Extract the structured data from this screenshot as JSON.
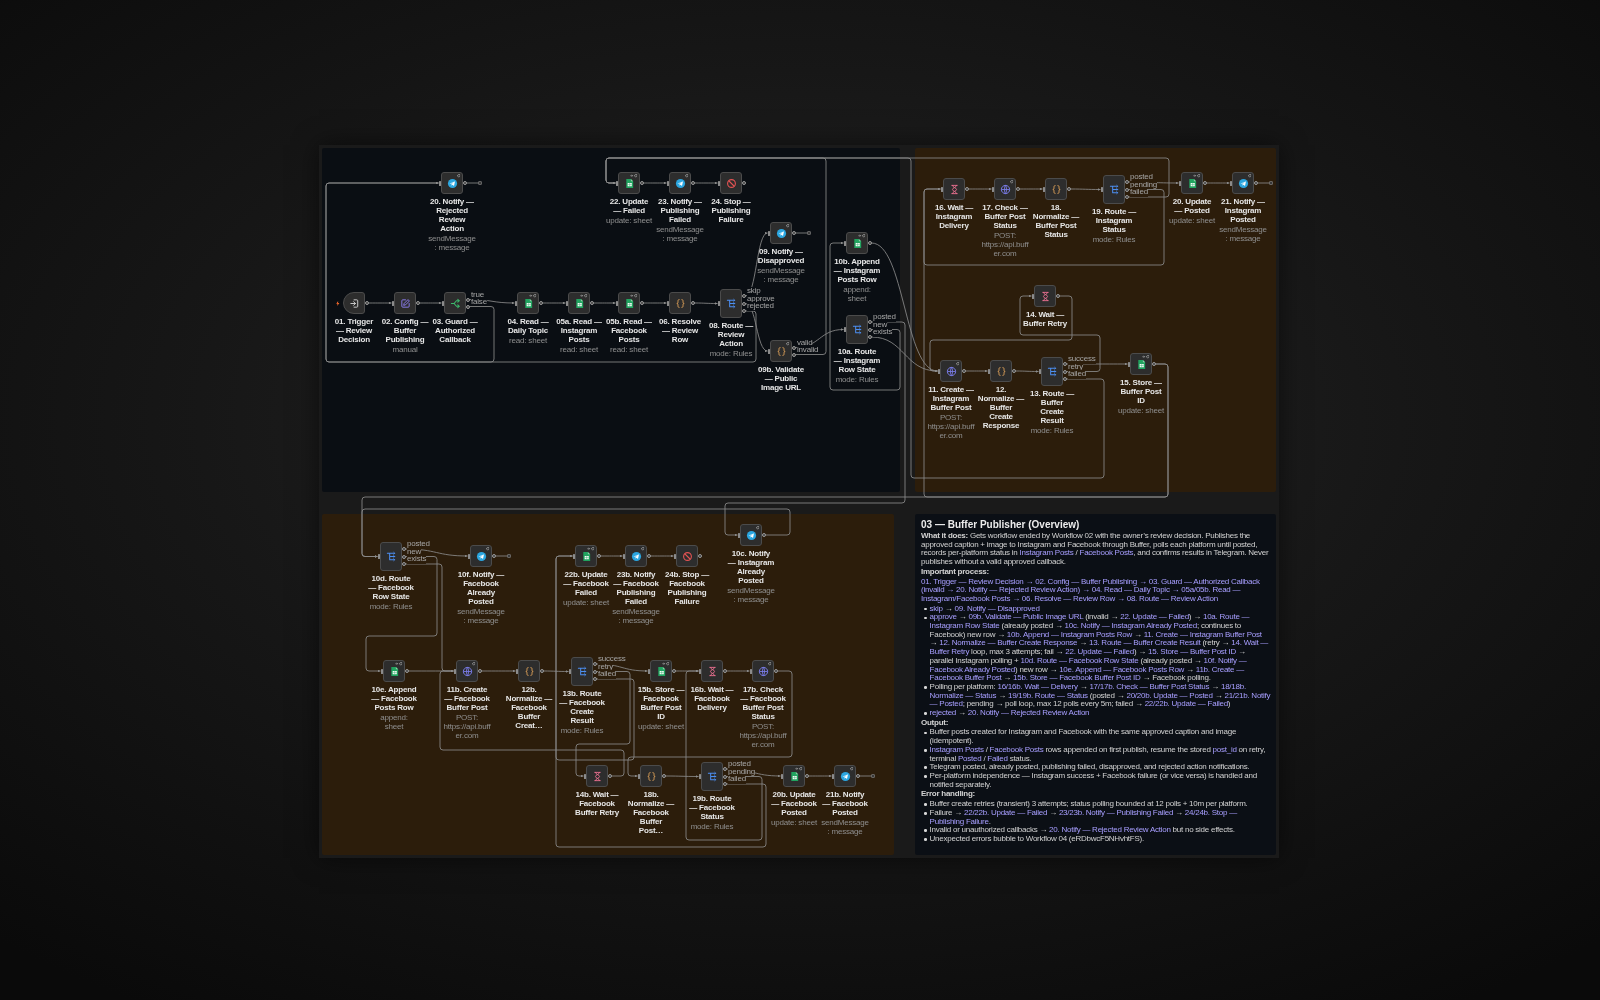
{
  "canvas": {
    "nodes": [
      {
        "label": "20. Notify — Rejected Review Action",
        "subtitle": "sendMessage: message",
        "kind": "telegram",
        "retries": true,
        "always_outputs": false
      },
      {
        "label": "22. Update — Failed",
        "subtitle": "update: sheet",
        "kind": "sheets",
        "retries": true,
        "always_outputs": true
      },
      {
        "label": "23. Notify — Publishing Failed",
        "subtitle": "sendMessage: message",
        "kind": "telegram",
        "retries": true,
        "always_outputs": false
      },
      {
        "label": "24. Stop — Publishing Failure",
        "kind": "stop",
        "retries": false,
        "always_outputs": false
      },
      {
        "label": "16. Wait — Instagram Delivery",
        "kind": "wait",
        "retries": false,
        "always_outputs": false
      },
      {
        "label": "17. Check — Buffer Post Status",
        "subtitle": "POST: https://api.buffer.com",
        "kind": "http",
        "retries": true,
        "always_outputs": false
      },
      {
        "label": "18. Normalize — Buffer Post Status",
        "kind": "code",
        "retries": false,
        "always_outputs": false
      },
      {
        "label": "19. Route — Instagram Status",
        "subtitle": "mode: Rules",
        "kind": "switch",
        "outputs": [
          "posted",
          "pending",
          "failed"
        ],
        "retries": false,
        "always_outputs": false
      },
      {
        "label": "20. Update — Posted",
        "subtitle": "update: sheet",
        "kind": "sheets",
        "retries": true,
        "always_outputs": true
      },
      {
        "label": "21. Notify — Instagram Posted",
        "subtitle": "sendMessage: message",
        "kind": "telegram",
        "retries": true,
        "always_outputs": false
      },
      {
        "label": "09. Notify — Disapproved",
        "subtitle": "sendMessage: message",
        "kind": "telegram",
        "retries": true,
        "always_outputs": false
      },
      {
        "label": "10b. Append — Instagram Posts Row",
        "subtitle": "append: sheet",
        "kind": "sheets",
        "retries": true,
        "always_outputs": true
      },
      {
        "label": "01. Trigger — Review Decision",
        "kind": "trigger",
        "retries": false,
        "always_outputs": false
      },
      {
        "label": "02. Config — Buffer Publishing",
        "subtitle": "manual",
        "kind": "set",
        "retries": false,
        "always_outputs": false
      },
      {
        "label": "03. Guard — Authorized Callback",
        "kind": "if",
        "outputs": [
          "true",
          "false"
        ],
        "retries": false,
        "always_outputs": false
      },
      {
        "label": "04. Read — Daily Topic",
        "subtitle": "read: sheet",
        "kind": "sheets",
        "retries": true,
        "always_outputs": true
      },
      {
        "label": "05a. Read — Instagram Posts",
        "subtitle": "read: sheet",
        "kind": "sheets",
        "retries": true,
        "always_outputs": true
      },
      {
        "label": "05b. Read — Facebook Posts",
        "subtitle": "read: sheet",
        "kind": "sheets",
        "retries": true,
        "always_outputs": true
      },
      {
        "label": "06. Resolve — Review Row",
        "kind": "code",
        "retries": false,
        "always_outputs": false
      },
      {
        "label": "08. Route — Review Action",
        "subtitle": "mode: Rules",
        "kind": "switch",
        "outputs": [
          "skip",
          "approve",
          "rejected"
        ],
        "retries": false,
        "always_outputs": false
      },
      {
        "label": "14. Wait — Buffer Retry",
        "kind": "wait",
        "retries": false,
        "always_outputs": false
      },
      {
        "label": "09b. Validate — Public Image URL",
        "kind": "code",
        "outputs": [
          "valid",
          "invalid"
        ],
        "retries": true,
        "always_outputs": false
      },
      {
        "label": "10a. Route — Instagram Row State",
        "subtitle": "mode: Rules",
        "kind": "switch",
        "outputs": [
          "posted",
          "new",
          "exists"
        ],
        "retries": false,
        "always_outputs": false
      },
      {
        "label": "11. Create — Instagram Buffer Post",
        "subtitle": "POST: https://api.buffer.com",
        "kind": "http",
        "retries": true,
        "always_outputs": false
      },
      {
        "label": "12. Normalize — Buffer Create Response",
        "kind": "code",
        "retries": false,
        "always_outputs": false
      },
      {
        "label": "13. Route — Buffer Create Result",
        "subtitle": "mode: Rules",
        "kind": "switch",
        "outputs": [
          "success",
          "retry",
          "failed"
        ],
        "retries": false,
        "always_outputs": false
      },
      {
        "label": "15. Store — Buffer Post ID",
        "subtitle": "update: sheet",
        "kind": "sheets",
        "retries": true,
        "always_outputs": true
      },
      {
        "label": "10d. Route — Facebook Row State",
        "subtitle": "mode: Rules",
        "kind": "switch",
        "outputs": [
          "posted",
          "new",
          "exists"
        ],
        "retries": false,
        "always_outputs": false
      },
      {
        "label": "10f. Notify — Facebook Already Posted",
        "subtitle": "sendMessage: message",
        "kind": "telegram",
        "retries": true,
        "always_outputs": false
      },
      {
        "label": "22b. Update — Facebook Failed",
        "subtitle": "update: sheet",
        "kind": "sheets",
        "retries": true,
        "always_outputs": true
      },
      {
        "label": "23b. Notify — Facebook Publishing Failed",
        "subtitle": "sendMessage: message",
        "kind": "telegram",
        "retries": true,
        "always_outputs": false
      },
      {
        "label": "24b. Stop — Facebook Publishing Failure",
        "kind": "stop",
        "retries": false,
        "always_outputs": false
      },
      {
        "label": "10c. Notify — Instagram Already Posted",
        "subtitle": "sendMessage: message",
        "kind": "telegram",
        "retries": true,
        "always_outputs": false
      },
      {
        "label": "10e. Append — Facebook Posts Row",
        "subtitle": "append: sheet",
        "kind": "sheets",
        "retries": true,
        "always_outputs": true
      },
      {
        "label": "11b. Create — Facebook Buffer Post",
        "subtitle": "POST: https://api.buffer.com",
        "kind": "http",
        "retries": true,
        "always_outputs": false
      },
      {
        "label": "12b. Normalize — Facebook Buffer Creat…",
        "kind": "code",
        "retries": false,
        "always_outputs": false
      },
      {
        "label": "13b. Route — Facebook Create Result",
        "subtitle": "mode: Rules",
        "kind": "switch",
        "outputs": [
          "success",
          "retry",
          "failed"
        ],
        "retries": false,
        "always_outputs": false
      },
      {
        "label": "15b. Store — Facebook Buffer Post ID",
        "subtitle": "update: sheet",
        "kind": "sheets",
        "retries": true,
        "always_outputs": true
      },
      {
        "label": "16b. Wait — Facebook Delivery",
        "kind": "wait",
        "retries": false,
        "always_outputs": false
      },
      {
        "label": "17b. Check — Facebook Buffer Post Status",
        "subtitle": "POST: https://api.buffer.com",
        "kind": "http",
        "retries": true,
        "always_outputs": false
      },
      {
        "label": "14b. Wait — Facebook Buffer Retry",
        "kind": "wait",
        "retries": false,
        "always_outputs": false
      },
      {
        "label": "18b. Normalize — Facebook Buffer Post…",
        "kind": "code",
        "retries": false,
        "always_outputs": false
      },
      {
        "label": "19b. Route — Facebook Status",
        "subtitle": "mode: Rules",
        "kind": "switch",
        "outputs": [
          "posted",
          "pending",
          "failed"
        ],
        "retries": false,
        "always_outputs": false
      },
      {
        "label": "20b. Update — Facebook Posted",
        "subtitle": "update: sheet",
        "kind": "sheets",
        "retries": true,
        "always_outputs": true
      },
      {
        "label": "21b. Notify — Facebook Posted",
        "subtitle": "sendMessage: message",
        "kind": "telegram",
        "retries": true,
        "always_outputs": false
      }
    ],
    "overview_note": {
      "title": "03 — Buffer Publisher (Overview)",
      "blocks": [
        {
          "kind": "paragraph",
          "segments": [
            {
              "kind": "bold",
              "text": "What it does:"
            },
            {
              "kind": "text",
              "text": " Gets workflow ended by Workflow 02 with the owner’s review decision. Publishes the approved caption + image to Instagram and Facebook through Buffer, polls each platform until posted, records per-platform status in "
            },
            {
              "kind": "code",
              "text": "Instagram Posts"
            },
            {
              "kind": "text",
              "text": " / "
            },
            {
              "kind": "code",
              "text": "Facebook Posts"
            },
            {
              "kind": "text",
              "text": ", and confirms results in Telegram. Never publishes without a valid approved callback."
            }
          ]
        },
        {
          "kind": "heading",
          "text": "Important process:"
        },
        {
          "kind": "paragraph",
          "segments": [
            {
              "kind": "code",
              "text": "01. Trigger — Review Decision → 02. Config — Buffer Publishing → 03. Guard — Authorized Callback (invalid → 20. Notify — Rejected Review Action) → 04. Read — Daily Topic → 05a/05b. Read — Instagram/Facebook Posts → 06. Resolve — Review Row → 08. Route — Review Action"
            }
          ]
        },
        {
          "kind": "list",
          "items": [
            {
              "segments": [
                {
                  "kind": "code",
                  "text": "skip"
                },
                {
                  "kind": "text",
                  "text": " → "
                },
                {
                  "kind": "code",
                  "text": "09. Notify — Disapproved"
                }
              ]
            },
            {
              "segments": [
                {
                  "kind": "code",
                  "text": "approve"
                },
                {
                  "kind": "text",
                  "text": " → "
                },
                {
                  "kind": "code",
                  "text": "09b. Validate — Public Image URL"
                },
                {
                  "kind": "text",
                  "text": " (invalid → "
                },
                {
                  "kind": "code",
                  "text": "22. Update — Failed"
                },
                {
                  "kind": "text",
                  "text": ") → "
                },
                {
                  "kind": "code",
                  "text": "10a. Route — Instagram Row State"
                },
                {
                  "kind": "text",
                  "text": " (already posted → "
                },
                {
                  "kind": "code",
                  "text": "10c. Notify — Instagram Already Posted"
                },
                {
                  "kind": "text",
                  "text": "; continues to Facebook) new row → "
                },
                {
                  "kind": "code",
                  "text": "10b. Append — Instagram Posts Row"
                },
                {
                  "kind": "text",
                  "text": " → "
                },
                {
                  "kind": "code",
                  "text": "11. Create — Instagram Buffer Post"
                },
                {
                  "kind": "text",
                  "text": " → "
                },
                {
                  "kind": "code",
                  "text": "12. Normalize — Buffer Create Response"
                },
                {
                  "kind": "text",
                  "text": " → "
                },
                {
                  "kind": "code",
                  "text": "13. Route — Buffer Create Result"
                },
                {
                  "kind": "text",
                  "text": " (retry → "
                },
                {
                  "kind": "code",
                  "text": "14. Wait — Buffer Retry"
                },
                {
                  "kind": "text",
                  "text": " loop, max 3 attempts; fail → "
                },
                {
                  "kind": "code",
                  "text": "22. Update — Failed"
                },
                {
                  "kind": "text",
                  "text": ") → "
                },
                {
                  "kind": "code",
                  "text": "15. Store — Buffer Post ID"
                },
                {
                  "kind": "text",
                  "text": " → parallel Instagram polling + "
                },
                {
                  "kind": "code",
                  "text": "10d. Route — Facebook Row State"
                },
                {
                  "kind": "text",
                  "text": " (already posted → "
                },
                {
                  "kind": "code",
                  "text": "10f. Notify — Facebook Already Posted"
                },
                {
                  "kind": "text",
                  "text": ") new row → "
                },
                {
                  "kind": "code",
                  "text": "10e. Append — Facebook Posts Row"
                },
                {
                  "kind": "text",
                  "text": " → "
                },
                {
                  "kind": "code",
                  "text": "11b. Create — Facebook Buffer Post"
                },
                {
                  "kind": "text",
                  "text": " → "
                },
                {
                  "kind": "code",
                  "text": "15b. Store — Facebook Buffer Post ID"
                },
                {
                  "kind": "text",
                  "text": " → Facebook polling."
                }
              ]
            },
            {
              "segments": [
                {
                  "kind": "text",
                  "text": "Polling per platform: "
                },
                {
                  "kind": "code",
                  "text": "16/16b. Wait — Delivery"
                },
                {
                  "kind": "text",
                  "text": " → "
                },
                {
                  "kind": "code",
                  "text": "17/17b. Check — Buffer Post Status"
                },
                {
                  "kind": "text",
                  "text": " → "
                },
                {
                  "kind": "code",
                  "text": "18/18b. Normalize — Status"
                },
                {
                  "kind": "text",
                  "text": " → "
                },
                {
                  "kind": "code",
                  "text": "19/19b. Route — Status"
                },
                {
                  "kind": "text",
                  "text": " (posted → "
                },
                {
                  "kind": "code",
                  "text": "20/20b. Update — Posted"
                },
                {
                  "kind": "text",
                  "text": " → "
                },
                {
                  "kind": "code",
                  "text": "21/21b. Notify — Posted"
                },
                {
                  "kind": "text",
                  "text": "; pending → poll loop, max 12 polls every 5m; failed → "
                },
                {
                  "kind": "code",
                  "text": "22/22b. Update — Failed"
                },
                {
                  "kind": "text",
                  "text": ")"
                }
              ]
            },
            {
              "segments": [
                {
                  "kind": "code",
                  "text": "rejected"
                },
                {
                  "kind": "text",
                  "text": " → "
                },
                {
                  "kind": "code",
                  "text": "20. Notify — Rejected Review Action"
                }
              ]
            }
          ]
        },
        {
          "kind": "heading",
          "text": "Output:"
        },
        {
          "kind": "list",
          "items": [
            {
              "segments": [
                {
                  "kind": "text",
                  "text": "Buffer posts created for Instagram and Facebook with the same approved caption and image (idempotent)."
                }
              ]
            },
            {
              "segments": [
                {
                  "kind": "code",
                  "text": "Instagram Posts"
                },
                {
                  "kind": "text",
                  "text": " / "
                },
                {
                  "kind": "code",
                  "text": "Facebook Posts"
                },
                {
                  "kind": "text",
                  "text": " rows appended on first publish, resume the stored "
                },
                {
                  "kind": "code",
                  "text": "post_id"
                },
                {
                  "kind": "text",
                  "text": " on retry, terminal "
                },
                {
                  "kind": "code",
                  "text": "Posted"
                },
                {
                  "kind": "text",
                  "text": " / "
                },
                {
                  "kind": "code",
                  "text": "Failed"
                },
                {
                  "kind": "text",
                  "text": " status."
                }
              ]
            },
            {
              "segments": [
                {
                  "kind": "text",
                  "text": "Telegram posted, already posted, publishing failed, disapproved, and rejected action notifications."
                }
              ]
            },
            {
              "segments": [
                {
                  "kind": "text",
                  "text": "Per-platform independence — Instagram success + Facebook failure (or vice versa) is handled and notified separately."
                }
              ]
            }
          ]
        },
        {
          "kind": "heading",
          "text": "Error handling:"
        },
        {
          "kind": "list",
          "items": [
            {
              "segments": [
                {
                  "kind": "text",
                  "text": "Buffer create retries (transient) 3 attempts; status polling bounded at 12 polls + 10m per platform."
                }
              ]
            },
            {
              "segments": [
                {
                  "kind": "text",
                  "text": "Failure → "
                },
                {
                  "kind": "code",
                  "text": "22/22b. Update — Failed"
                },
                {
                  "kind": "text",
                  "text": " → "
                },
                {
                  "kind": "code",
                  "text": "23/23b. Notify — Publishing Failed"
                },
                {
                  "kind": "text",
                  "text": " → "
                },
                {
                  "kind": "code",
                  "text": "24/24b. Stop — Publishing Failure"
                },
                {
                  "kind": "text",
                  "text": "."
                }
              ]
            },
            {
              "segments": [
                {
                  "kind": "text",
                  "text": "Invalid or unauthorized callbacks → "
                },
                {
                  "kind": "code",
                  "text": "20. Notify — Rejected Review Action"
                },
                {
                  "kind": "text",
                  "text": " but no side effects."
                }
              ]
            },
            {
              "segments": [
                {
                  "kind": "text",
                  "text": "Unexpected errors bubble to Workflow 04 (eRDbwcF5NHvhtFS)."
                }
              ]
            }
          ]
        }
      ]
    }
  }
}
